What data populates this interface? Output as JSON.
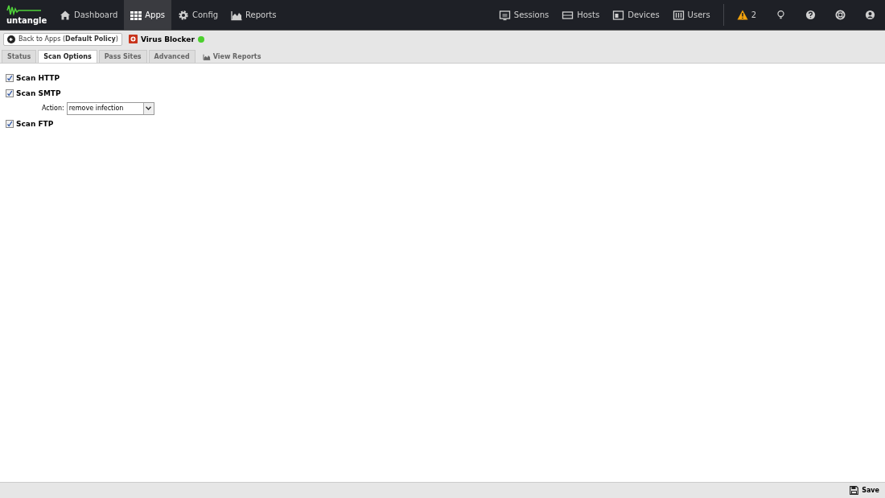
{
  "nav": {
    "logo": "untangle",
    "left": [
      {
        "label": "Dashboard",
        "selected": false
      },
      {
        "label": "Apps",
        "selected": true
      },
      {
        "label": "Config",
        "selected": false
      },
      {
        "label": "Reports",
        "selected": false
      }
    ],
    "right": [
      {
        "label": "Sessions"
      },
      {
        "label": "Hosts"
      },
      {
        "label": "Devices"
      },
      {
        "label": "Users"
      }
    ],
    "alerts": "2"
  },
  "breadcrumb": {
    "back": "Back to Apps (**Default Policy**)",
    "app": "Virus Blocker",
    "running": true
  },
  "tabs": [
    {
      "label": "Status",
      "selected": false
    },
    {
      "label": "Scan Options",
      "selected": true
    },
    {
      "label": "Pass Sites",
      "selected": false
    },
    {
      "label": "Advanced",
      "selected": false
    },
    {
      "label": "View Reports",
      "kind": "link",
      "selected": false
    }
  ],
  "options": [
    {
      "kind": "checkbox",
      "label": "Scan HTTP",
      "checked": true
    },
    {
      "kind": "checkbox",
      "label": "Scan SMTP",
      "checked": true
    },
    {
      "kind": "select",
      "label": "Action:",
      "value": "remove infection"
    },
    {
      "kind": "checkbox",
      "label": "Scan FTP",
      "checked": true
    }
  ],
  "footer": {
    "save": "Save"
  }
}
